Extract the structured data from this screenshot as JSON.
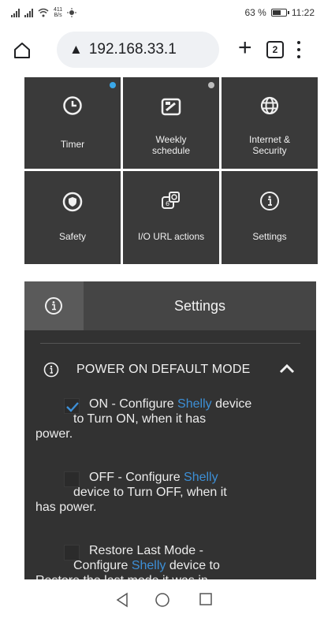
{
  "status_bar": {
    "rate_top": "411",
    "rate_bottom": "B/s",
    "battery": "63 %",
    "battery_level": 0.63,
    "time": "11:22"
  },
  "browser": {
    "url": "192.168.33.1",
    "tab_count": "2"
  },
  "tiles": [
    {
      "label": "Timer",
      "icon": "clock-icon",
      "dot_color": "#3aa7e8"
    },
    {
      "label1": "Weekly",
      "label2": "schedule",
      "icon": "calendar-icon",
      "dot_color": "#bdbdbd"
    },
    {
      "label1": "Internet &",
      "label2": "Security",
      "icon": "globe-icon"
    },
    {
      "label": "Safety",
      "icon": "shield-icon"
    },
    {
      "label": "I/O URL actions",
      "icon": "io-icon"
    },
    {
      "label": "Settings",
      "icon": "info-icon"
    }
  ],
  "settings_header": {
    "title": "Settings"
  },
  "power_on": {
    "title": "POWER ON DEFAULT MODE",
    "options": [
      {
        "checked": true,
        "pre": "ON - Configure ",
        "brand": "Shelly",
        "post1": " device",
        "line2": "to Turn ON, when it has",
        "line3": "power."
      },
      {
        "checked": false,
        "pre": "OFF - Configure ",
        "brand": "Shelly",
        "post1": "",
        "line2": "device to Turn OFF, when it",
        "line3": "has power."
      },
      {
        "checked": false,
        "pre": "Restore Last Mode -",
        "line2_pre": "Configure ",
        "brand": "Shelly",
        "line2_post": " device to",
        "line3": "Restore the last mode it was in,"
      }
    ]
  },
  "colors": {
    "accent": "#3d8fd6",
    "tile": "#3a3a3a",
    "panel": "#323232"
  }
}
